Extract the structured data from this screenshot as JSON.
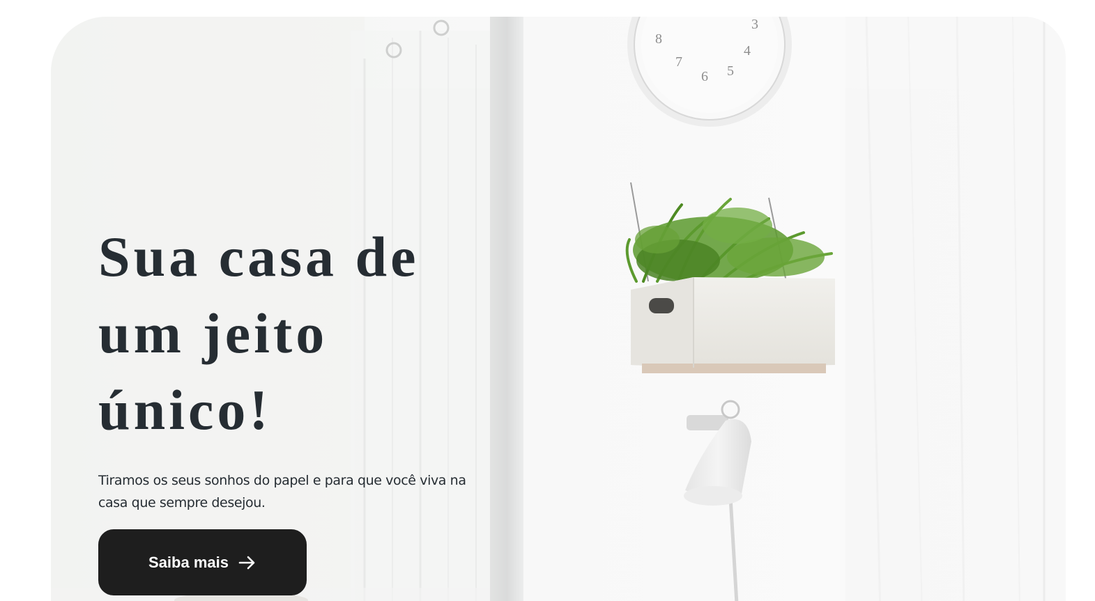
{
  "hero": {
    "title_lines": [
      "Sua casa de",
      "um jeito",
      "único!"
    ],
    "subtitle": "Tiramos os seus sonhos do papel e para que você viva na casa que sempre desejou.",
    "cta": {
      "label": "Saiba mais",
      "icon": "arrow-right-icon"
    },
    "image": {
      "clock_numbers": [
        "3",
        "4",
        "5",
        "6",
        "7",
        "8"
      ],
      "description_icons": [
        "wall-clock",
        "plant-box-shelf",
        "wall-lamp",
        "curtain"
      ]
    }
  },
  "colors": {
    "title": "#262d33",
    "button_bg": "#1e1e1e",
    "button_text": "#ffffff",
    "background": "#ffffff",
    "plant_green": "#5c9a2e"
  }
}
